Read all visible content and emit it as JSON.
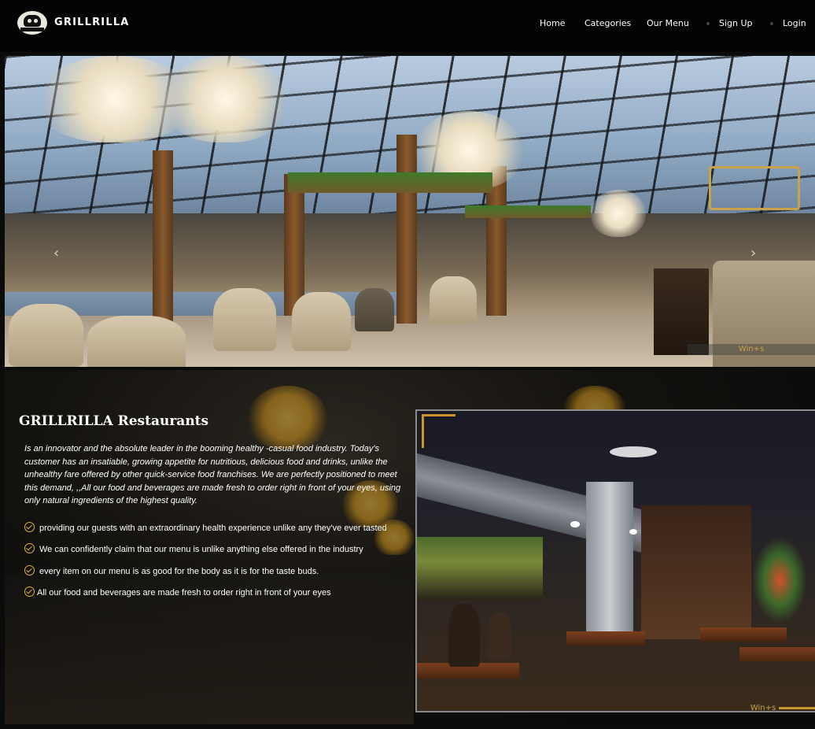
{
  "brand": {
    "name": "GRILLRILLA"
  },
  "nav": {
    "home": "Home",
    "categories": "Categories",
    "menu": "Our Menu",
    "signup": "Sign Up",
    "login": "Login"
  },
  "hero": {
    "watermark": "Win+s"
  },
  "about": {
    "title": "GRILLRILLA Restaurants",
    "description": "Is an innovator and the absolute leader in the booming healthy -casual food industry. Today's customer has an insatiable, growing appetite for nutritious, delicious food and drinks, unlike the unhealthy fare offered by other quick-service food franchises. We are perfectly positioned to meet this demand, ,,All our food and beverages are made fresh to order right in front of your eyes, using only natural ingredients of the highest quality.",
    "features": [
      "providing our guests with an extraordinary health experience unlike any they've ever tasted",
      "We can confidently claim that our menu is unlike anything else offered in the industry",
      "every item on our menu is as good for the body as it is for the taste buds.",
      "All our food and beverages are made fresh to order right in front of your eyes"
    ],
    "image_watermark": "Win+s"
  },
  "colors": {
    "accent": "#e0b13a",
    "background": "#0b0b0b",
    "nav": "#030303"
  }
}
